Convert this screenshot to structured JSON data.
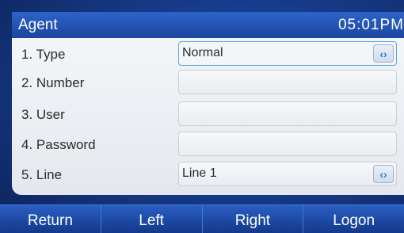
{
  "header": {
    "title": "Agent",
    "time": "05:01PM"
  },
  "form": {
    "rows": [
      {
        "label": "1. Type",
        "value": "Normal",
        "has_arrows": true
      },
      {
        "label": "2. Number",
        "value": ""
      },
      {
        "label": "3. User",
        "value": ""
      },
      {
        "label": "4. Password",
        "value": ""
      },
      {
        "label": "5. Line",
        "value": "Line 1",
        "has_arrows": true
      }
    ],
    "arrow_glyph": "‹›"
  },
  "softkeys": [
    "Return",
    "Left",
    "Right",
    "Logon"
  ]
}
